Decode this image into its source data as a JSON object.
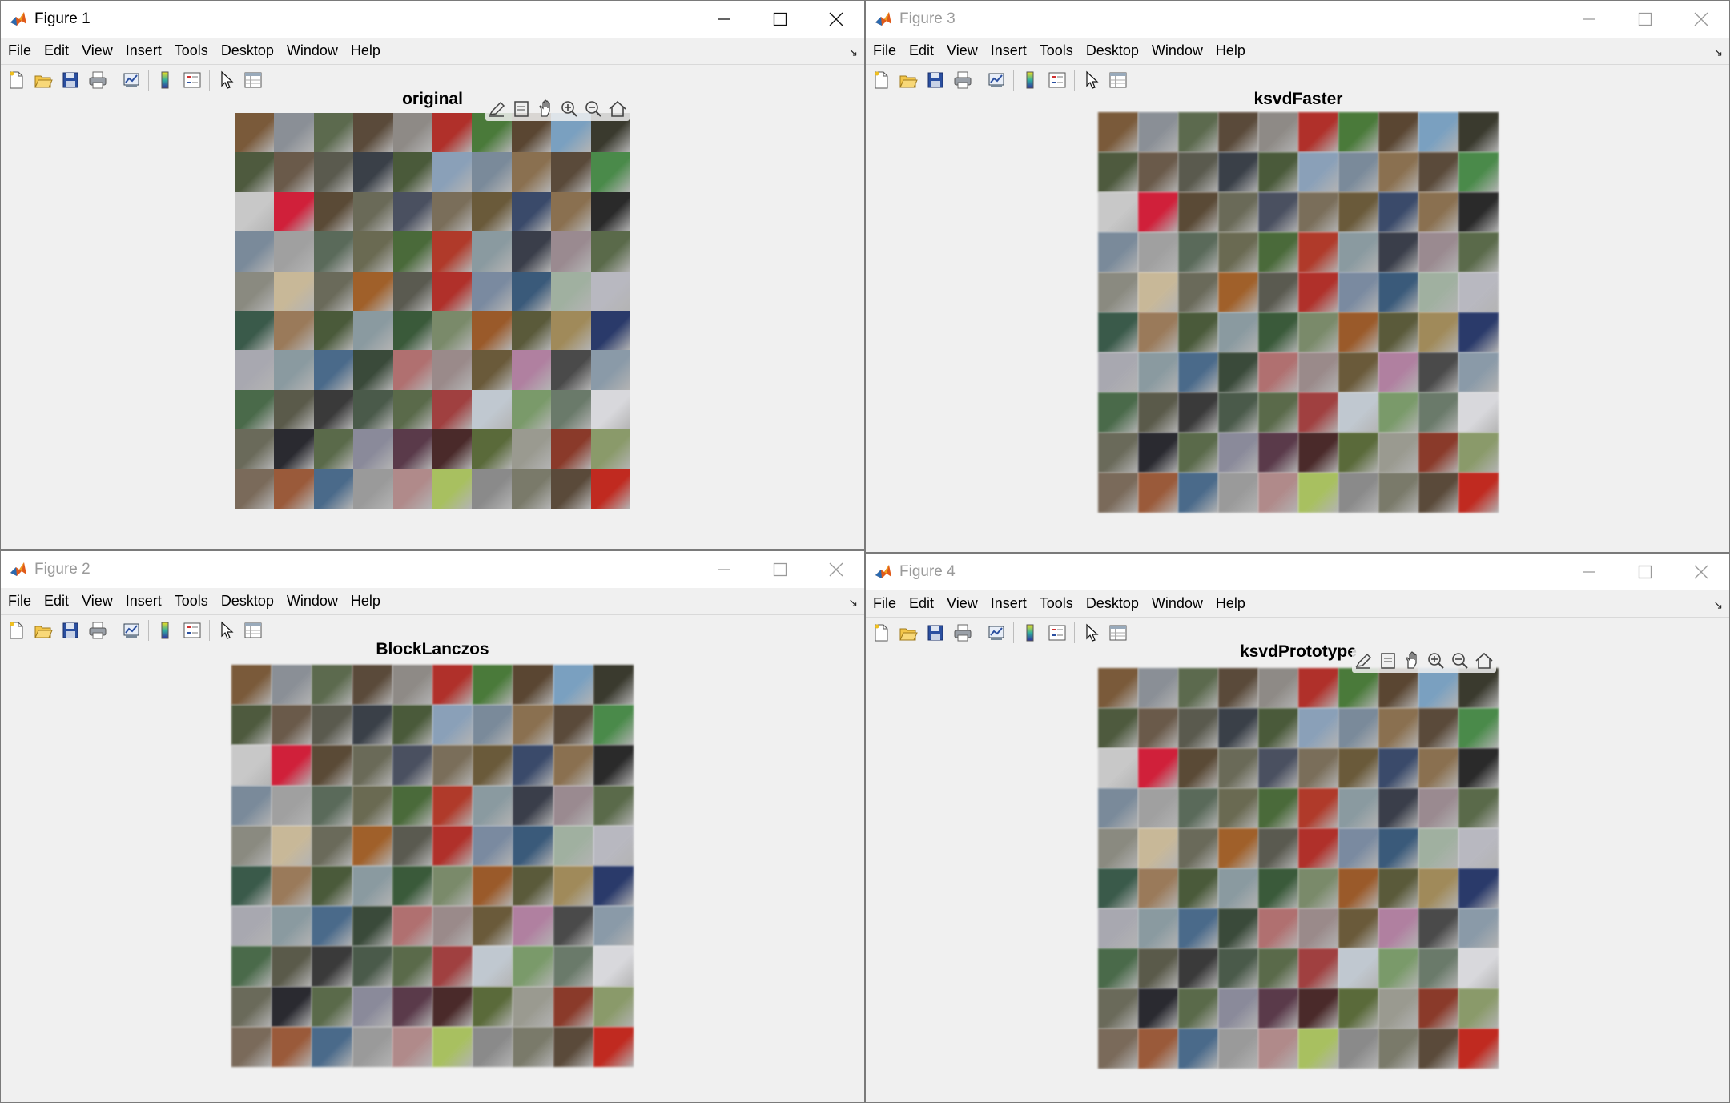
{
  "menu": [
    "File",
    "Edit",
    "View",
    "Insert",
    "Tools",
    "Desktop",
    "Window",
    "Help"
  ],
  "windows": [
    {
      "id": "fig1",
      "title": "Figure 1",
      "axes_title": "original",
      "active": true
    },
    {
      "id": "fig3",
      "title": "Figure 3",
      "axes_title": "ksvdFaster",
      "active": false
    },
    {
      "id": "fig2",
      "title": "Figure 2",
      "axes_title": "BlockLanczos",
      "active": false
    },
    {
      "id": "fig4",
      "title": "Figure 4",
      "axes_title": "ksvdPrototype",
      "active": false
    }
  ],
  "toolbar_icons": [
    "new-figure-icon",
    "open-file-icon",
    "save-icon",
    "print-icon",
    "link-plot-icon",
    "insert-colorbar-icon",
    "insert-legend-icon",
    "edit-plot-icon",
    "property-inspector-icon"
  ],
  "axes_toolbar_icons": [
    "brush-icon",
    "data-tips-icon",
    "pan-icon",
    "zoom-in-icon",
    "zoom-out-icon",
    "restore-view-icon"
  ],
  "image_grid": {
    "rows": 10,
    "cols": 10
  },
  "tile_colors": [
    "#7a5a3a",
    "#8a8f96",
    "#5c6a4e",
    "#5a4a3a",
    "#8e8a86",
    "#b0302a",
    "#4a7a3a",
    "#5a4632",
    "#7aa0c0",
    "#3a3a2e",
    "#4e5a3e",
    "#6a5a4a",
    "#5a5a4e",
    "#3a4048",
    "#4a5a3a",
    "#8aa0b8",
    "#7a8a9a",
    "#8a7050",
    "#5a4a3a",
    "#4a8a4a",
    "#c8c8c8",
    "#d0203a",
    "#5a4a36",
    "#6a6a58",
    "#4a5060",
    "#7a6e5a",
    "#6a5a3a",
    "#3a4a6a",
    "#8a7050",
    "#2a2a2a",
    "#7a8a9a",
    "#a0a0a0",
    "#5a6a5a",
    "#6a6a52",
    "#4a6a3a",
    "#b03a2a",
    "#8a9aa0",
    "#3a3e4a",
    "#9a8a90",
    "#5a6a4a",
    "#8a8a80",
    "#c8b898",
    "#6a6a5a",
    "#a0602a",
    "#5a5a50",
    "#b0302a",
    "#7a8aa0",
    "#3a5a7a",
    "#a0b0a0",
    "#b8b8c0",
    "#3a5a4a",
    "#9a7a5a",
    "#4a5a3a",
    "#8a9aa0",
    "#3a5a3a",
    "#7a8a6a",
    "#9a5a2a",
    "#5a5a3a",
    "#a08a5a",
    "#2a3a6a",
    "#a8a8b0",
    "#8a9aa0",
    "#4a6a8a",
    "#3a4a3a",
    "#b07070",
    "#9a8a8a",
    "#6a5a3a",
    "#b080a0",
    "#4a4a4a",
    "#8a9aa8",
    "#4a6a4a",
    "#5a5a4a",
    "#3a3a3a",
    "#4a5a4a",
    "#5a6a4a",
    "#a04040",
    "#c0c8d0",
    "#7a9a6a",
    "#6a7a6a",
    "#d8d8dc",
    "#6a6a5a",
    "#2a2a30",
    "#5a6a4a",
    "#8a8a9a",
    "#5a3a4a",
    "#4a2a2a",
    "#5a6a3a",
    "#9a9a90",
    "#8a3a2a",
    "#8a9a6a",
    "#7a6a5a",
    "#9a5a3a",
    "#4a6a8a",
    "#9a9a9a",
    "#b08a8a",
    "#a8c060",
    "#8a8a8a",
    "#7a7a6a",
    "#5a4a3a",
    "#c02a20"
  ]
}
